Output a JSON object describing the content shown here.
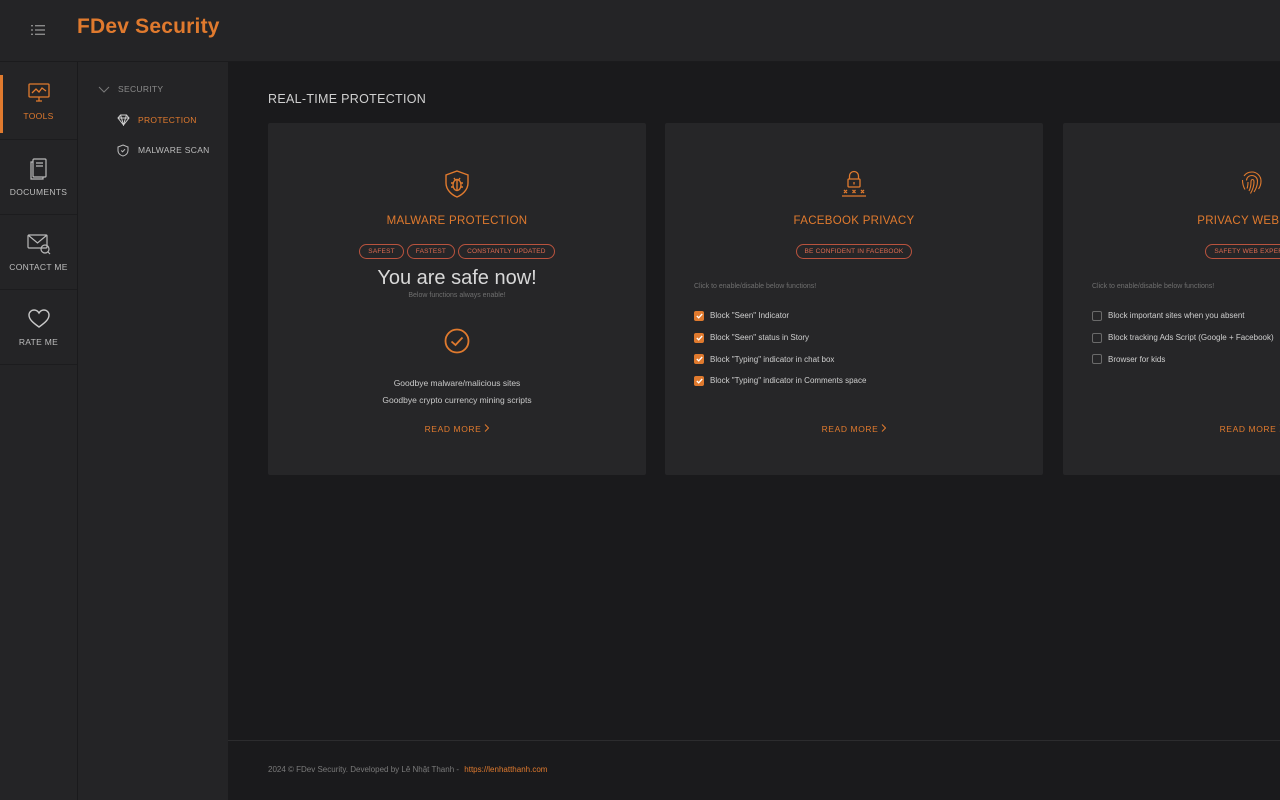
{
  "header": {
    "brand": "FDev Security"
  },
  "rail": {
    "items": [
      {
        "label": "TOOLS",
        "icon": "monitor-icon",
        "active": true
      },
      {
        "label": "DOCUMENTS",
        "icon": "book-icon",
        "active": false
      },
      {
        "label": "CONTACT ME",
        "icon": "mail-icon",
        "active": false
      },
      {
        "label": "RATE ME",
        "icon": "heart-icon",
        "active": false
      }
    ]
  },
  "subnav": {
    "group": "SECURITY",
    "items": [
      {
        "label": "PROTECTION",
        "icon": "diamond-icon",
        "active": true
      },
      {
        "label": "MALWARE SCAN",
        "icon": "shield-icon",
        "active": false
      }
    ]
  },
  "main": {
    "section_title": "REAL-TIME PROTECTION",
    "cards": [
      {
        "title": "MALWARE PROTECTION",
        "icon": "bug-shield-icon",
        "tags": [
          "SAFEST",
          "FASTEST",
          "CONSTANTLY UPDATED"
        ],
        "status": "You are safe now!",
        "status_sub": "Below functions always enable!",
        "lines": [
          "Goodbye malware/malicious sites",
          "Goodbye crypto currency mining scripts"
        ],
        "read_more": "READ MORE"
      },
      {
        "title": "FACEBOOK PRIVACY",
        "icon": "lock-password-icon",
        "tags": [
          "BE CONFIDENT IN FACEBOOK"
        ],
        "hint": "Click to enable/disable below functions!",
        "options": [
          {
            "label": "Block \"Seen\" Indicator",
            "checked": true
          },
          {
            "label": "Block \"Seen\" status in Story",
            "checked": true
          },
          {
            "label": "Block \"Typing\" indicator in chat box",
            "checked": true
          },
          {
            "label": "Block \"Typing\" indicator in Comments space",
            "checked": true
          }
        ],
        "read_more": "READ MORE"
      },
      {
        "title": "PRIVACY WEB EXP",
        "icon": "fingerprint-icon",
        "tags": [
          "SAFETY WEB EXPERIE"
        ],
        "hint": "Click to enable/disable below functions!",
        "options": [
          {
            "label": "Block important sites when you absent",
            "checked": false
          },
          {
            "label": "Block tracking Ads Script (Google + Facebook)",
            "checked": false
          },
          {
            "label": "Browser for kids",
            "checked": false
          }
        ],
        "read_more": "READ MORE"
      }
    ]
  },
  "footer": {
    "text": "2024 © FDev Security. Developed by Lê Nhật Thanh - ",
    "link": "https://lenhatthanh.com"
  },
  "colors": {
    "accent": "#e07a2e",
    "tag_border": "#b9533e",
    "background": "#1a1a1c",
    "panel": "#242426",
    "card": "#262628"
  }
}
